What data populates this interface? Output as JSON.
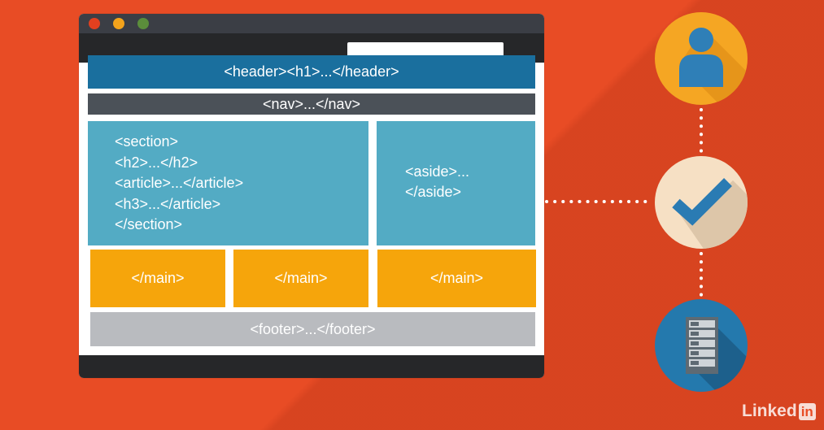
{
  "diagram": {
    "header_block": "<header><h1>...</header>",
    "nav_block": "<nav>...</nav>",
    "section_lines": [
      "<section>",
      "<h2>...</h2>",
      "<article>...</article>",
      "<h3>...</article>",
      "</section>"
    ],
    "aside_lines": [
      "<aside>...",
      "</aside>"
    ],
    "main_blocks": [
      "</main>",
      "</main>",
      "</main>"
    ],
    "footer_block": "<footer>...</footer>"
  },
  "icons": {
    "user": "user-icon",
    "check": "checkmark-icon",
    "server": "server-icon"
  },
  "colors": {
    "background": "#e84c25",
    "header": "#1a6f9e",
    "nav": "#4b5158",
    "section": "#53abc4",
    "main": "#f6a50b",
    "footer": "#b9bbbf"
  },
  "logo": {
    "linked": "Linked",
    "in": "in"
  }
}
